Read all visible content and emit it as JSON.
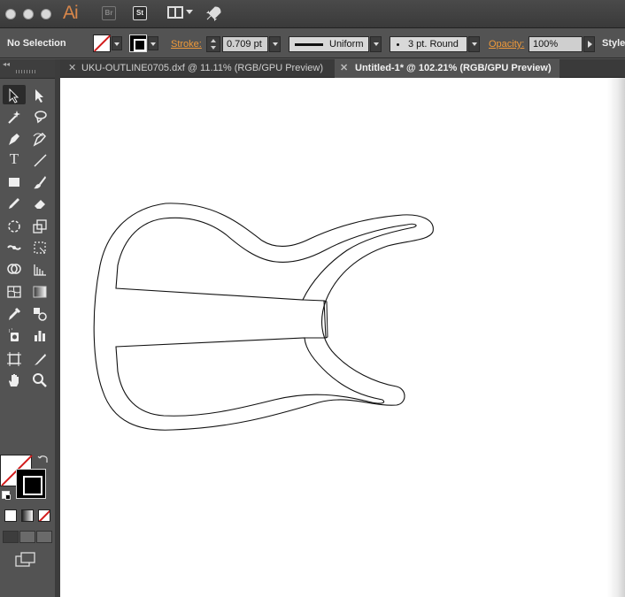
{
  "app": {
    "logo": "Ai",
    "bridge_button": "Br",
    "stock_button": "St"
  },
  "control_bar": {
    "selection_label": "No Selection",
    "stroke_link": "Stroke:",
    "stroke_weight": "0.709 pt",
    "variable_width": "Uniform",
    "brush": "3 pt. Round",
    "opacity_link": "Opacity:",
    "opacity_value": "100%",
    "style_label": "Style:"
  },
  "tabs": [
    {
      "label": "UKU-OUTLINE0705.dxf @ 11.11% (RGB/GPU Preview)",
      "active": false
    },
    {
      "label": "Untitled-1* @ 102.21% (RGB/GPU Preview)",
      "active": true
    }
  ],
  "colors": {
    "panel_bg": "#535353",
    "accent_orange": "#f09a3a",
    "no_fill_red": "#d21a1a",
    "canvas_bg": "#ffffff"
  },
  "tools": [
    "selection-tool-icon",
    "direct-selection-tool-icon",
    "magic-wand-tool-icon",
    "lasso-tool-icon",
    "pen-tool-icon",
    "curvature-tool-icon",
    "type-tool-icon",
    "line-segment-tool-icon",
    "rectangle-tool-icon",
    "paintbrush-tool-icon",
    "pencil-tool-icon",
    "eraser-tool-icon",
    "rotate-tool-icon",
    "scale-tool-icon",
    "width-tool-icon",
    "free-transform-tool-icon",
    "shape-builder-tool-icon",
    "perspective-grid-tool-icon",
    "mesh-tool-icon",
    "gradient-tool-icon",
    "eyedropper-tool-icon",
    "blend-tool-icon",
    "symbol-sprayer-tool-icon",
    "column-graph-tool-icon",
    "artboard-tool-icon",
    "slice-tool-icon",
    "hand-tool-icon",
    "zoom-tool-icon"
  ]
}
